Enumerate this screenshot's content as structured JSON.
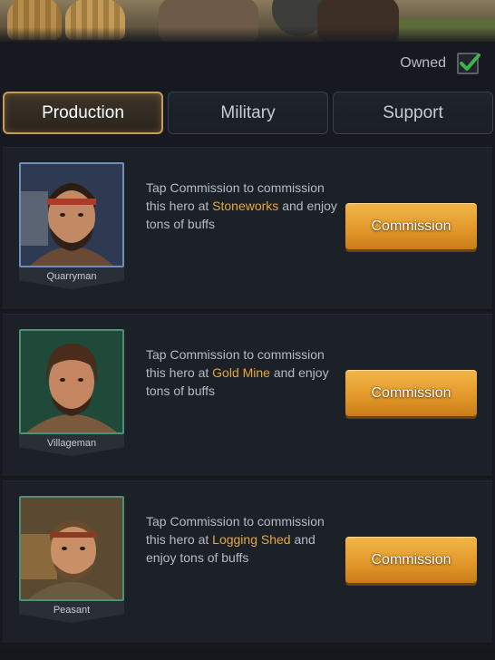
{
  "owned": {
    "label": "Owned",
    "checked": true
  },
  "tabs": [
    {
      "label": "Production",
      "active": true
    },
    {
      "label": "Military",
      "active": false
    },
    {
      "label": "Support",
      "active": false
    }
  ],
  "heroes": [
    {
      "name": "Quarryman",
      "desc_pre": "Tap Commission to commission this hero at ",
      "building": "Stoneworks",
      "desc_post": " and enjoy tons of buffs",
      "button": "Commission"
    },
    {
      "name": "Villageman",
      "desc_pre": "Tap Commission to commission this hero at ",
      "building": "Gold Mine",
      "desc_post": " and enjoy tons of buffs",
      "button": "Commission"
    },
    {
      "name": "Peasant",
      "desc_pre": "Tap Commission to commission this hero at ",
      "building": "Logging Shed",
      "desc_post": " and enjoy tons of buffs",
      "button": "Commission"
    }
  ],
  "colors": {
    "accent": "#e6a93a",
    "button": "#e39a2a",
    "check": "#3fb14e",
    "blue_frame": "#6f8fb8",
    "green_frame": "#4f8f74"
  }
}
